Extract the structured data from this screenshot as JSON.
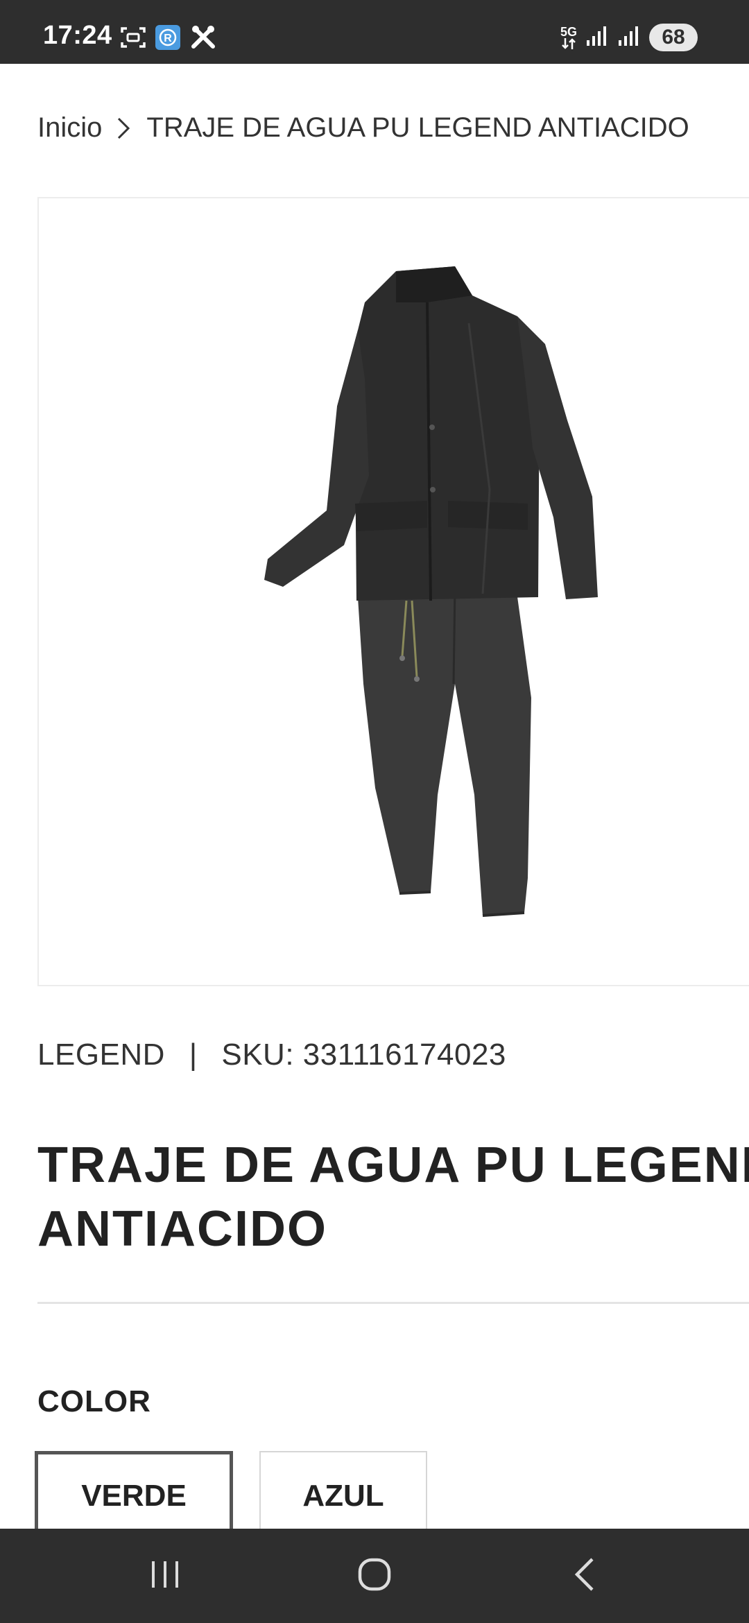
{
  "status_bar": {
    "time": "17:24",
    "network": "5G",
    "battery": "68",
    "icons": [
      "screenshot-icon",
      "app-r-icon",
      "tools-icon",
      "signal-icon",
      "signal-icon",
      "battery-icon"
    ]
  },
  "breadcrumb": {
    "home": "Inicio",
    "current": "TRAJE DE AGUA PU LEGEND ANTIACIDO"
  },
  "product": {
    "image_alt": "rain-suit-image",
    "brand": "LEGEND",
    "separator": "|",
    "sku": "SKU: 331116174023",
    "title": "TRAJE DE AGUA PU LEGEND ANTIACIDO"
  },
  "options": {
    "color_label": "COLOR",
    "colors": [
      "VERDE",
      "AZUL"
    ],
    "selected": "VERDE"
  },
  "nav_bar": {
    "buttons": [
      "recent-apps",
      "home",
      "back"
    ]
  },
  "colors": {
    "bars": "#2e2e2e",
    "text": "#222222",
    "selected_border": "#555555"
  }
}
